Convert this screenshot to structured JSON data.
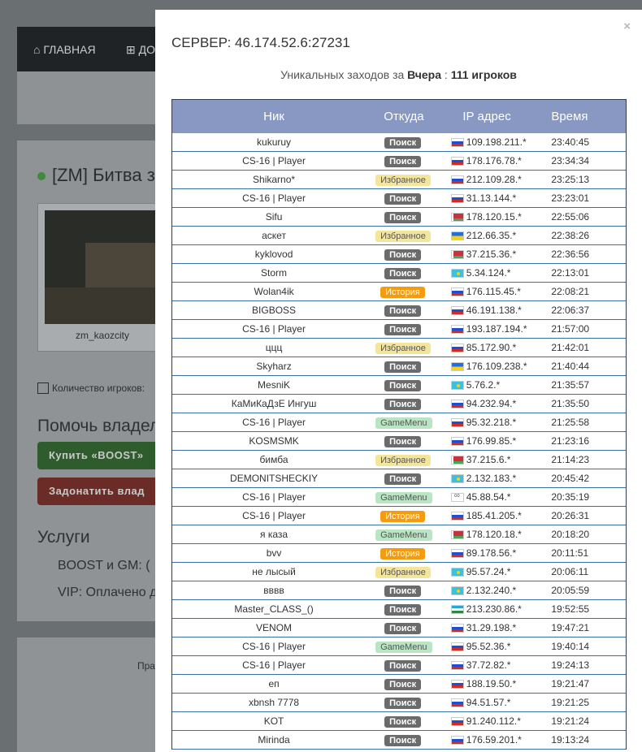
{
  "background": {
    "nav": [
      {
        "icon": "home-icon",
        "label": "ГЛАВНАЯ"
      },
      {
        "icon": "plus-square-icon",
        "label": "ДО"
      }
    ],
    "server_title": "[ZM] Битва за",
    "thumb_caption": "zm_kaozcity",
    "players_label": "Количество игроков:",
    "help_heading": "Помочь владел",
    "boost_button": "Купить «BOOST»",
    "donate_button": "Задонатить влад",
    "services_heading": "Услуги",
    "services": [
      "BOOST и GM:   (",
      "VIP:   Оплачено д"
    ],
    "footer_text": "Пра"
  },
  "modal": {
    "close": "×",
    "title": "СЕРВЕР: 46.174.52.6:27231",
    "subtitle_prefix": "Уникальных заходов за ",
    "subtitle_period": "Вчера",
    "subtitle_sep": " : ",
    "subtitle_count": "111 игроков",
    "columns": {
      "nick": "Ник",
      "from": "Откуда",
      "ip": "IP адрес",
      "time": "Время"
    },
    "rows": [
      {
        "nick": "kukuruy",
        "from": "Поиск",
        "type": "search",
        "flag": "ru",
        "ip": "109.198.211.*",
        "time": "23:40:45"
      },
      {
        "nick": "CS-16 | Player",
        "from": "Поиск",
        "type": "search",
        "flag": "ru",
        "ip": "178.176.78.*",
        "time": "23:34:34"
      },
      {
        "nick": "Shikarno*",
        "from": "Избранное",
        "type": "fav",
        "flag": "ru",
        "ip": "212.109.28.*",
        "time": "23:25:13"
      },
      {
        "nick": "CS-16 | Player",
        "from": "Поиск",
        "type": "search",
        "flag": "ru",
        "ip": "31.13.144.*",
        "time": "23:23:01"
      },
      {
        "nick": "Sifu",
        "from": "Поиск",
        "type": "search",
        "flag": "by",
        "ip": "178.120.15.*",
        "time": "22:55:06"
      },
      {
        "nick": "аскет",
        "from": "Избранное",
        "type": "fav",
        "flag": "ua",
        "ip": "212.66.35.*",
        "time": "22:38:26"
      },
      {
        "nick": "kyklovod",
        "from": "Поиск",
        "type": "search",
        "flag": "by",
        "ip": "37.215.36.*",
        "time": "22:36:56"
      },
      {
        "nick": "Storm",
        "from": "Поиск",
        "type": "search",
        "flag": "kz",
        "ip": "5.34.124.*",
        "time": "22:13:01"
      },
      {
        "nick": "Wolan4ik",
        "from": "История",
        "type": "hist",
        "flag": "ru",
        "ip": "176.115.45.*",
        "time": "22:08:21"
      },
      {
        "nick": "BIGBOSS",
        "from": "Поиск",
        "type": "search",
        "flag": "ru",
        "ip": "46.191.138.*",
        "time": "22:06:37"
      },
      {
        "nick": "CS-16 | Player",
        "from": "Поиск",
        "type": "search",
        "flag": "ru",
        "ip": "193.187.194.*",
        "time": "21:57:00"
      },
      {
        "nick": "ццц",
        "from": "Избранное",
        "type": "fav",
        "flag": "ru",
        "ip": "85.172.90.*",
        "time": "21:42:01"
      },
      {
        "nick": "Skyharz",
        "from": "Поиск",
        "type": "search",
        "flag": "ua",
        "ip": "176.109.238.*",
        "time": "21:40:44"
      },
      {
        "nick": "MesniK",
        "from": "Поиск",
        "type": "search",
        "flag": "kz",
        "ip": "5.76.2.*",
        "time": "21:35:57"
      },
      {
        "nick": "КаМиКаДзЕ Ингуш",
        "from": "Поиск",
        "type": "search",
        "flag": "ru",
        "ip": "94.232.94.*",
        "time": "21:35:50"
      },
      {
        "nick": "CS-16 | Player",
        "from": "GameMenu",
        "type": "gm",
        "flag": "ru",
        "ip": "95.32.218.*",
        "time": "21:25:58"
      },
      {
        "nick": "KOSMSMK",
        "from": "Поиск",
        "type": "search",
        "flag": "ru",
        "ip": "176.99.85.*",
        "time": "21:23:16"
      },
      {
        "nick": "бимба",
        "from": "Избранное",
        "type": "fav",
        "flag": "by",
        "ip": "37.215.6.*",
        "time": "21:14:23"
      },
      {
        "nick": "DEMONITSHECKIY",
        "from": "Поиск",
        "type": "search",
        "flag": "kz",
        "ip": "2.132.183.*",
        "time": "20:45:42"
      },
      {
        "nick": "CS-16 | Player",
        "from": "GameMenu",
        "type": "gm",
        "flag": "ol",
        "ip": "45.88.54.*",
        "time": "20:35:19"
      },
      {
        "nick": "CS-16 | Player",
        "from": "История",
        "type": "hist",
        "flag": "ru",
        "ip": "185.41.205.*",
        "time": "20:26:31"
      },
      {
        "nick": "я каза",
        "from": "GameMenu",
        "type": "gm",
        "flag": "by",
        "ip": "178.120.18.*",
        "time": "20:18:20"
      },
      {
        "nick": "bvv",
        "from": "История",
        "type": "hist",
        "flag": "ru",
        "ip": "89.178.56.*",
        "time": "20:11:51"
      },
      {
        "nick": "не лысый",
        "from": "Избранное",
        "type": "fav",
        "flag": "kz",
        "ip": "95.57.24.*",
        "time": "20:06:11"
      },
      {
        "nick": "вввв",
        "from": "Поиск",
        "type": "search",
        "flag": "kz",
        "ip": "2.132.240.*",
        "time": "20:05:59"
      },
      {
        "nick": "Master_CLASS_()",
        "from": "Поиск",
        "type": "search",
        "flag": "uz",
        "ip": "213.230.86.*",
        "time": "19:52:55"
      },
      {
        "nick": "VENOM",
        "from": "Поиск",
        "type": "search",
        "flag": "ru",
        "ip": "31.29.198.*",
        "time": "19:47:21"
      },
      {
        "nick": "CS-16 | Player",
        "from": "GameMenu",
        "type": "gm",
        "flag": "ru",
        "ip": "95.52.36.*",
        "time": "19:40:14"
      },
      {
        "nick": "CS-16 | Player",
        "from": "Поиск",
        "type": "search",
        "flag": "ru",
        "ip": "37.72.82.*",
        "time": "19:24:13"
      },
      {
        "nick": "еп",
        "from": "Поиск",
        "type": "search",
        "flag": "ru",
        "ip": "188.19.50.*",
        "time": "19:21:47"
      },
      {
        "nick": "xbnsh 7778",
        "from": "Поиск",
        "type": "search",
        "flag": "ru",
        "ip": "94.51.57.*",
        "time": "19:21:25"
      },
      {
        "nick": "KOT",
        "from": "Поиск",
        "type": "search",
        "flag": "ru",
        "ip": "91.240.112.*",
        "time": "19:21:24"
      },
      {
        "nick": "Mirinda",
        "from": "Поиск",
        "type": "search",
        "flag": "ru",
        "ip": "176.59.201.*",
        "time": "19:13:24"
      }
    ]
  }
}
